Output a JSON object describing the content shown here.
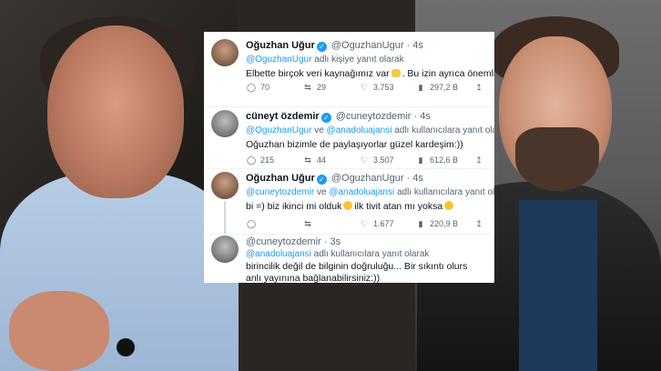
{
  "tweets": [
    {
      "name": "Oğuzhan Uğur",
      "handle": "@OguzhanUgur",
      "time": "4s",
      "reply_to": [
        "@OguzhanUgur"
      ],
      "reply_suffix": "adlı kişiye yanıt olarak",
      "text_before": "Elbette birçok veri kaynağımız var",
      "text_after": ". Bu izin ayrıca önemliydi.",
      "stats": {
        "replies": "70",
        "retweets": "29",
        "likes": "3.753",
        "views": "297,2 B"
      }
    },
    {
      "name": "cüneyt özdemir",
      "handle": "@cuneytozdemir",
      "time": "4s",
      "reply_to": [
        "@OguzhanUgur",
        "@anadoluajansi"
      ],
      "reply_join": "ve",
      "reply_suffix": "adlı kullanıcılara yanıt olarak",
      "text": "Oğuzhan bizimle de paylaşıyorlar güzel kardeşim:))",
      "stats": {
        "replies": "215",
        "retweets": "44",
        "likes": "3.507",
        "views": "612,6 B"
      }
    },
    {
      "name": "Oğuzhan Uğur",
      "handle": "@OguzhanUgur",
      "time": "4s",
      "reply_to": [
        "@cuneytozdemir",
        "@anadoluajansi"
      ],
      "reply_join": "ve",
      "reply_suffix": "adlı kullanıcılara yanıt olarak",
      "text_before": "bi =) biz ikinci mi olduk",
      "text_after": "ilk tivit atan mı yoksa",
      "stats": {
        "replies": "",
        "retweets": "",
        "likes": "1.677",
        "views": "220,9 B"
      }
    },
    {
      "name": "",
      "handle": "@cuneytozdemir",
      "time": "3s",
      "reply_to": [
        "@anadoluajansi"
      ],
      "reply_suffix": "adlı kullanıcılara yanıt olarak",
      "text_line1": "birincilik değil de bilginin doğruluğu... Bir sıkıntı olurs",
      "text_line2": "anlı yayınına bağlanabilirsiniz:))"
    }
  ],
  "icons": {
    "reply": "speech-bubble",
    "retweet": "retweet-arrows",
    "like": "heart",
    "views": "bar-chart",
    "share": "upload-arrow",
    "verified": "verified-badge"
  },
  "colors": {
    "link": "#1d9bf0",
    "text": "#0f1419",
    "muted": "#536471"
  }
}
